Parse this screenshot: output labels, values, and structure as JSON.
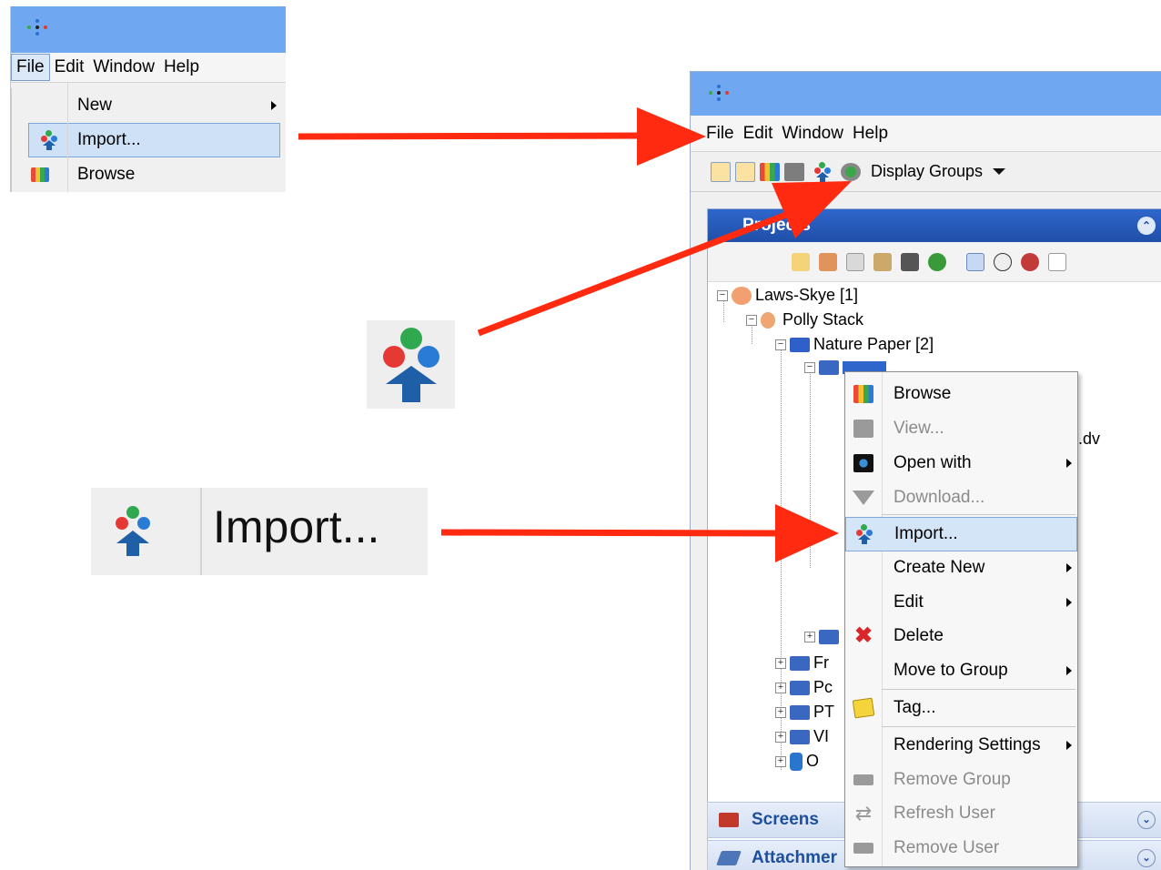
{
  "menu": {
    "file": "File",
    "edit": "Edit",
    "window": "Window",
    "help": "Help"
  },
  "file_menu": {
    "new": "New",
    "import": "Import...",
    "browse": "Browse"
  },
  "toolbar": {
    "display_groups": "Display Groups"
  },
  "projects": {
    "header": "Projects",
    "tree": {
      "root": "Laws-Skye [1]",
      "user": "Polly Stack",
      "project": "Nature Paper [2]",
      "file_suffix": "..dv",
      "partial": [
        "Fr",
        "Pc",
        "PT",
        "VI",
        "O"
      ]
    }
  },
  "context_menu": [
    {
      "label": "Browse",
      "enabled": true
    },
    {
      "label": "View...",
      "enabled": false
    },
    {
      "label": "Open with",
      "enabled": true
    },
    {
      "label": "Download...",
      "enabled": false
    },
    {
      "label": "Import...",
      "enabled": true
    },
    {
      "label": "Create New",
      "enabled": true
    },
    {
      "label": "Edit",
      "enabled": true
    },
    {
      "label": "Delete",
      "enabled": true
    },
    {
      "label": "Move to Group",
      "enabled": true
    },
    {
      "label": "Tag...",
      "enabled": true
    },
    {
      "label": "Rendering Settings",
      "enabled": true
    },
    {
      "label": "Remove Group",
      "enabled": false
    },
    {
      "label": "Refresh User",
      "enabled": false
    },
    {
      "label": "Remove User",
      "enabled": false
    }
  ],
  "bottom_panels": {
    "screens": "Screens",
    "attachments": "Attachmer"
  },
  "zoom": {
    "import_label": "Import..."
  },
  "colors": {
    "titlebar": "#6fa8f0",
    "header_blue": "#2456b8",
    "highlight": "#cfe1f7",
    "arrow": "#ff2a10"
  }
}
